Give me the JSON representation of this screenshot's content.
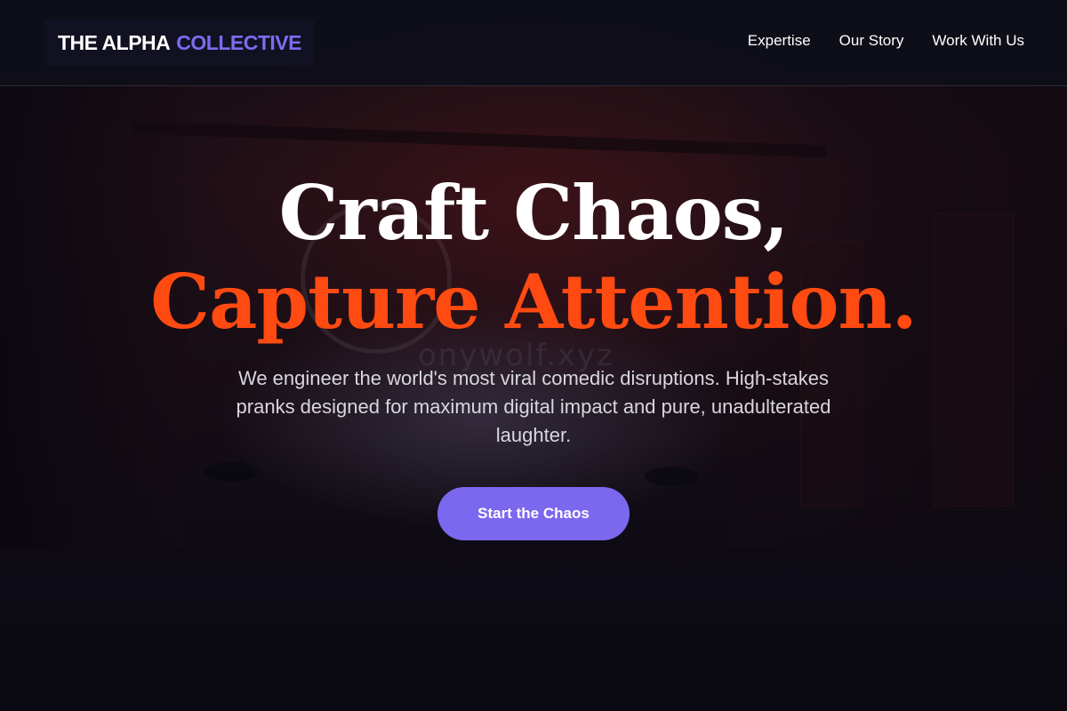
{
  "brand": {
    "name_main": "THE ALPHA",
    "name_accent": "COLLECTIVE"
  },
  "nav": {
    "items": [
      "Expertise",
      "Our Story",
      "Work With Us"
    ]
  },
  "hero": {
    "headline_line1": "Craft Chaos,",
    "headline_line2": "Capture Attention.",
    "subtitle": "We engineer the world's most viral comedic disruptions. High-stakes pranks designed for maximum digital impact and pure, unadulterated laughter.",
    "cta_label": "Start the Chaos",
    "background_watermark": "onywolf.xyz"
  },
  "colors": {
    "accent_purple": "#7b68ee",
    "headline_orange": "#ff4a12",
    "background": "#0c0b14",
    "text_white": "#ffffff"
  }
}
